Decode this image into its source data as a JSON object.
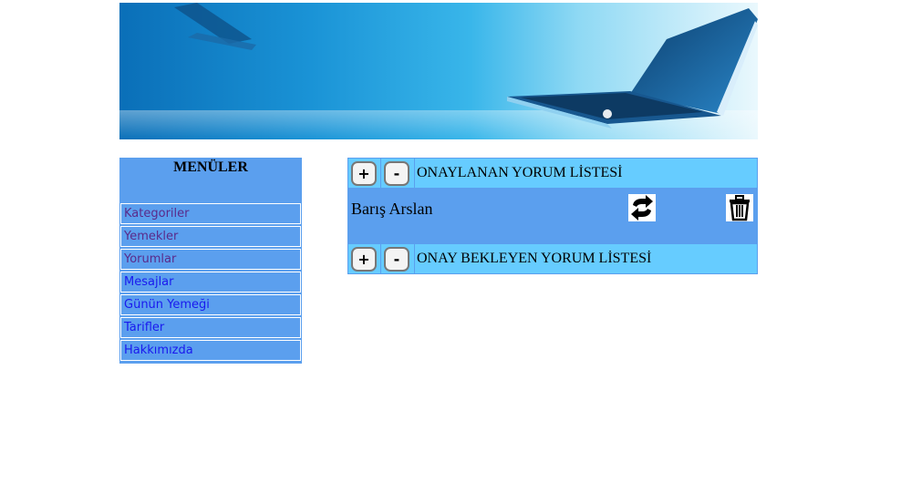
{
  "menu": {
    "title": "MENÜLER",
    "items": [
      {
        "label": "Kategoriler",
        "visited": true
      },
      {
        "label": "Yemekler",
        "visited": true
      },
      {
        "label": "Yorumlar",
        "visited": true
      },
      {
        "label": "Mesajlar",
        "visited": false
      },
      {
        "label": "Günün Yemeği",
        "visited": false
      },
      {
        "label": "Tarifler",
        "visited": false
      },
      {
        "label": "Hakkımızda",
        "visited": false
      }
    ]
  },
  "comments": {
    "approved_title": "ONAYLANAN YORUM LİSTESİ",
    "pending_title": "ONAY BEKLEYEN YORUM LİSTESİ",
    "expand_label": "+",
    "collapse_label": "-",
    "entries": [
      {
        "author": "Barış Arslan",
        "actions": [
          "refresh-icon",
          "trash-icon"
        ]
      }
    ]
  },
  "colors": {
    "panel": "#5b9fee",
    "header_row": "#66ccff",
    "link": "#1a1aee",
    "visited_link": "#5a2a8a"
  }
}
